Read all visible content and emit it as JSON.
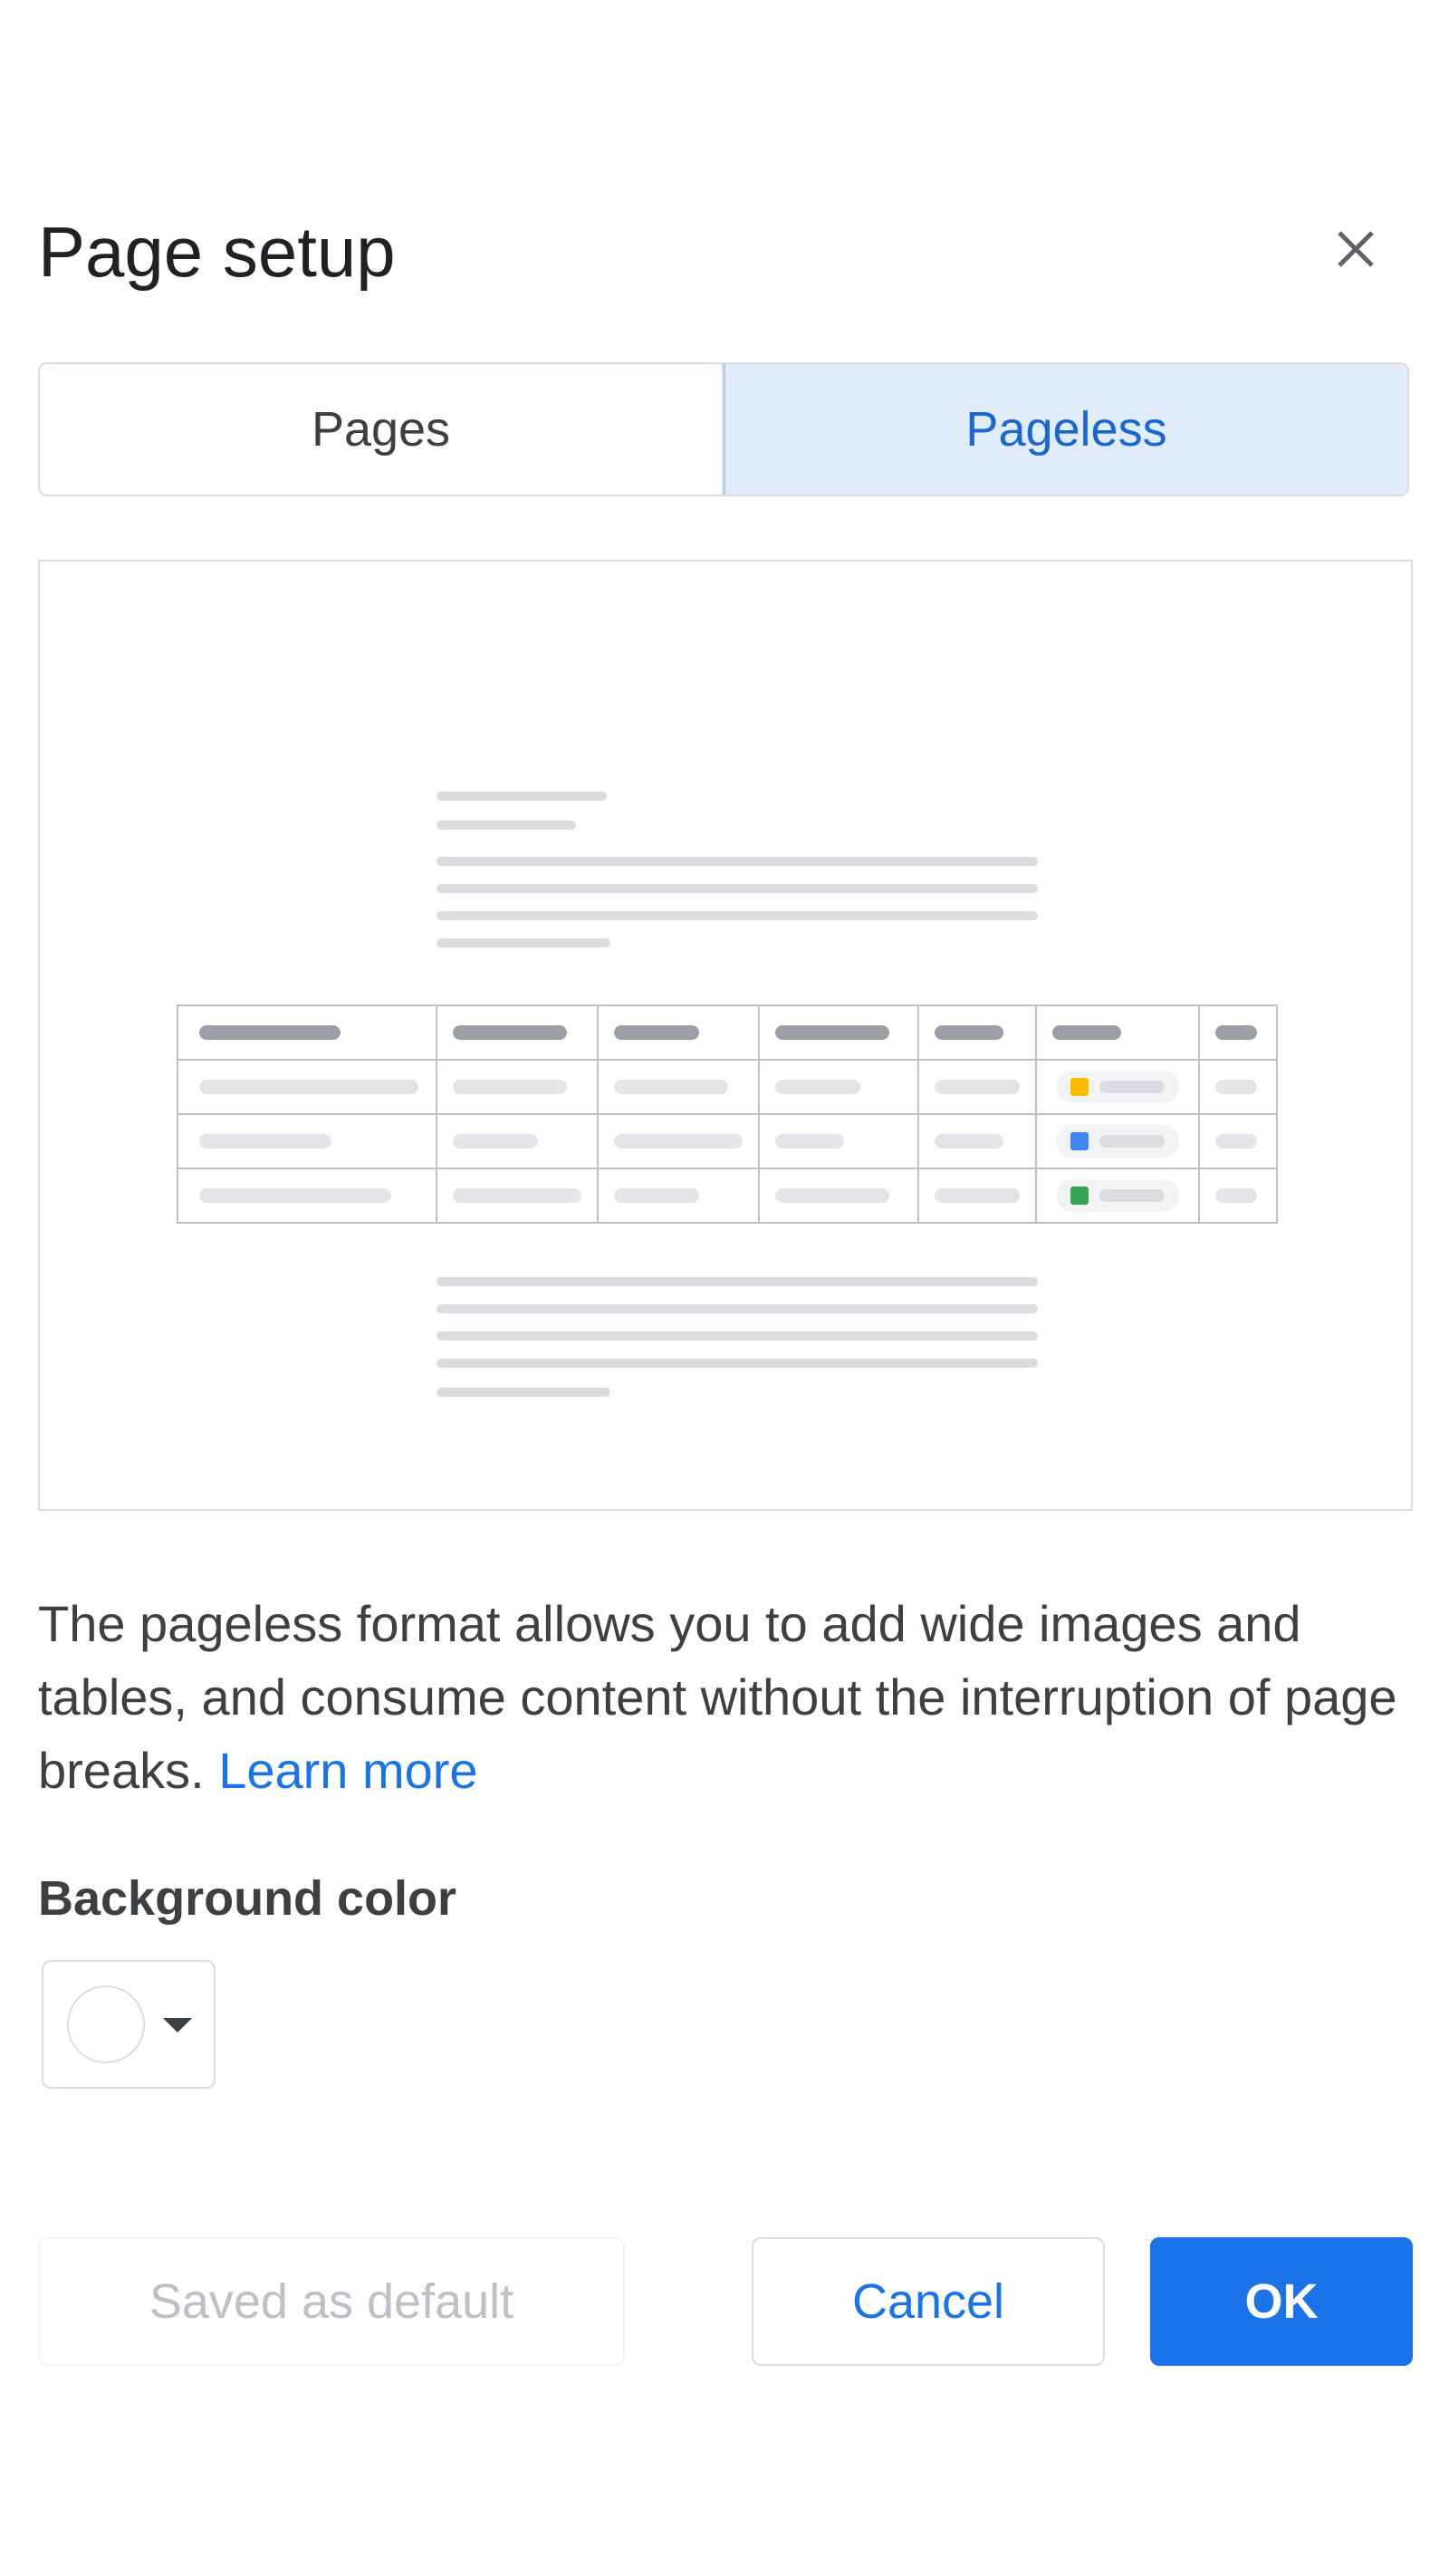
{
  "dialog": {
    "title": "Page setup",
    "close_icon": "close-icon"
  },
  "tabs": [
    {
      "label": "Pages",
      "selected": false
    },
    {
      "label": "Pageless",
      "selected": true
    }
  ],
  "preview": {
    "description": "Illustration of a pageless document with text lines and a wide table",
    "status_chip_colors": [
      "#fbbc04",
      "#4285f4",
      "#34a853"
    ]
  },
  "description": {
    "text": "The pageless format allows you to add wide images and tables, and consume content without the interruption of page breaks.",
    "link": "Learn more"
  },
  "background": {
    "label": "Background color",
    "selected_color": "#ffffff",
    "caret_icon": "caret-down-icon"
  },
  "buttons": {
    "set_default": "Saved as default",
    "cancel": "Cancel",
    "ok": "OK"
  },
  "colors": {
    "accent": "#1a73e8",
    "selected_tab_bg": "#e1ecfb",
    "border": "#dadce0"
  }
}
